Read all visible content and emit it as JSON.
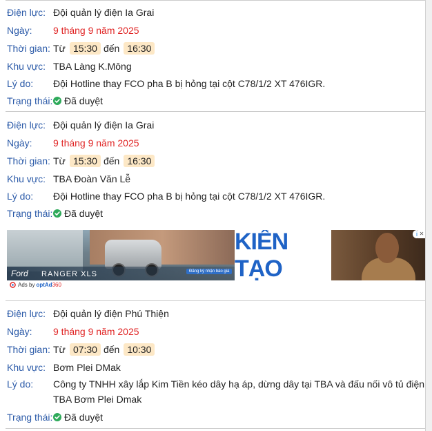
{
  "labels": {
    "dien_luc": "Điện lực:",
    "ngay": "Ngày:",
    "thoi_gian": "Thời gian:",
    "khu_vuc": "Khu vực:",
    "ly_do": "Lý do:",
    "trang_thai": "Trạng thái:",
    "tu": "Từ",
    "den": "đến"
  },
  "records": [
    {
      "dien_luc": "Đội quản lý điện Ia Grai",
      "ngay": "9 tháng 9 năm 2025",
      "tu": "15:30",
      "den": "16:30",
      "khu_vuc": "TBA Làng K.Mông",
      "ly_do": [
        "Đội Hotline thay FCO pha B bị hỏng tại cột C78/1/2 XT 476IGR."
      ],
      "trang_thai": "Đã duyệt"
    },
    {
      "dien_luc": "Đội quản lý điện Ia Grai",
      "ngay": "9 tháng 9 năm 2025",
      "tu": "15:30",
      "den": "16:30",
      "khu_vuc": "TBA Đoàn Văn Lễ",
      "ly_do": [
        "Đội Hotline thay FCO pha B bị hỏng tại cột C78/1/2 XT 476IGR."
      ],
      "trang_thai": "Đã duyệt"
    },
    {
      "dien_luc": "Đội quản lý điện Phú Thiện",
      "ngay": "9 tháng 9 năm 2025",
      "tu": "07:30",
      "den": "10:30",
      "khu_vuc": "Bơm Plei DMak",
      "ly_do": [
        "Công ty TNHH xây lắp Kim Tiền kéo dây hạ áp, dừng dây tại TBA và đấu nối vô tủ điện",
        "TBA Bơm Plei Dmak"
      ],
      "trang_thai": "Đã duyệt"
    }
  ],
  "ad": {
    "brand": "Ford",
    "model": "RANGER XLS",
    "cta": "Đăng ký nhận báo giá",
    "headline": "KIẾN TẠO",
    "ads_by": "Ads by",
    "optad": "optAd",
    "optad360": "360",
    "info_glyph": "i",
    "close_glyph": "✕"
  },
  "colors": {
    "label": "#2b5aa8",
    "date": "#e02424",
    "time_bg": "#fde8c6",
    "check": "#2eaa5a"
  }
}
